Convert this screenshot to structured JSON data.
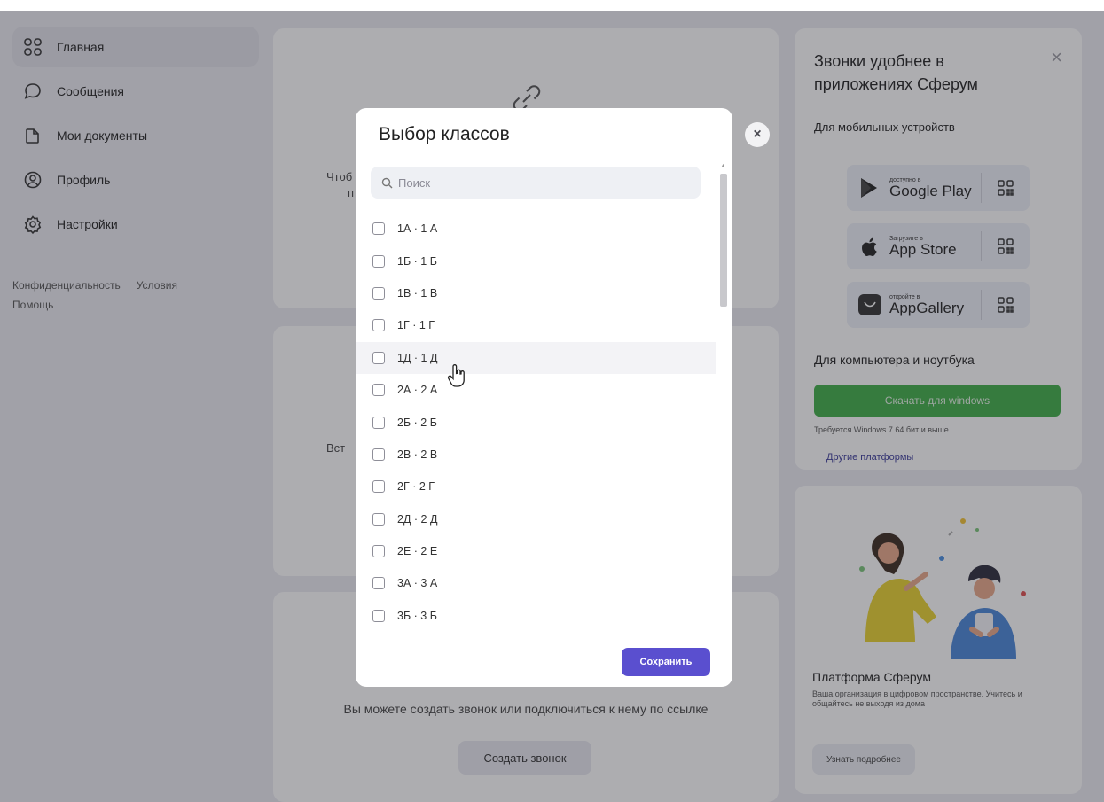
{
  "sidebar": {
    "items": [
      {
        "label": "Главная"
      },
      {
        "label": "Сообщения"
      },
      {
        "label": "Мои документы"
      },
      {
        "label": "Профиль"
      },
      {
        "label": "Настройки"
      }
    ],
    "footer": {
      "privacy": "Конфиденциальность",
      "terms": "Условия",
      "help": "Помощь"
    }
  },
  "main": {
    "partial1": "Чтоб",
    "partial2": "п",
    "partial3": "Вст",
    "call_text": "Вы можете создать звонок или подключиться к нему по ссылке",
    "create_call": "Создать звонок"
  },
  "promo": {
    "title": "Звонки удобнее в приложениях Сферум",
    "close": "×",
    "mobile": "Для мобильных устройств",
    "google": {
      "small": "доступно в",
      "big": "Google Play"
    },
    "apple": {
      "small": "Загрузите в",
      "big": "App Store"
    },
    "huawei": {
      "small": "откройте в",
      "big": "AppGallery"
    },
    "pc": "Для компьютера и ноутбука",
    "windows_button": "Скачать для windows",
    "requirements": "Требуется Windows 7 64 бит и выше",
    "other_platforms": "Другие платформы"
  },
  "platform": {
    "title": "Платформа Сферум",
    "description": "Ваша организация в цифровом пространстве. Учитесь и общайтесь не выходя из дома",
    "button": "Узнать подробнее"
  },
  "modal": {
    "title": "Выбор классов",
    "close": "×",
    "search_placeholder": "Поиск",
    "classes": [
      "1А · 1 А",
      "1Б · 1 Б",
      "1В · 1 В",
      "1Г · 1 Г",
      "1Д · 1 Д",
      "2А · 2 А",
      "2Б · 2 Б",
      "2В · 2 В",
      "2Г · 2 Г",
      "2Д · 2 Д",
      "2Е · 2 Е",
      "3А · 3 А",
      "3Б · 3 Б"
    ],
    "hovered_index": 4,
    "save": "Сохранить"
  },
  "colors": {
    "accent": "#5a4fcf",
    "download_green": "#3fae48"
  }
}
